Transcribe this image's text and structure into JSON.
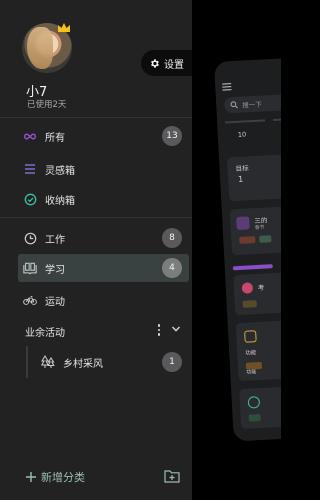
{
  "profile": {
    "username": "小7",
    "usage_text": "已使用2天"
  },
  "settings": {
    "label": "设置"
  },
  "nav": {
    "all": {
      "label": "所有",
      "count": "13"
    },
    "inspiration": {
      "label": "灵感箱"
    },
    "inbox": {
      "label": "收纳箱"
    },
    "work": {
      "label": "工作",
      "count": "8"
    },
    "study": {
      "label": "学习",
      "count": "4"
    },
    "sport": {
      "label": "运动"
    }
  },
  "group": {
    "title": "业余活动",
    "items": [
      {
        "label": "乡村采风",
        "count": "1"
      }
    ]
  },
  "footer": {
    "add_category": "新增分类"
  },
  "preview": {
    "search_placeholder": "搜一下",
    "tiny_texts": [
      "目标",
      "1",
      "10",
      "三的",
      "春节",
      "进度",
      "考",
      "目标",
      "功能",
      "功能",
      "好",
      "今"
    ]
  },
  "colors": {
    "drawer_bg": "#222223",
    "active_bg": "#3a4241",
    "all_icon": "#9b4fd6",
    "inspiration_icon": "#7a6fc9",
    "inbox_icon": "#3fbf9f",
    "accent_green": "#9dbdb4",
    "count_badge": "#5a5a5c"
  }
}
